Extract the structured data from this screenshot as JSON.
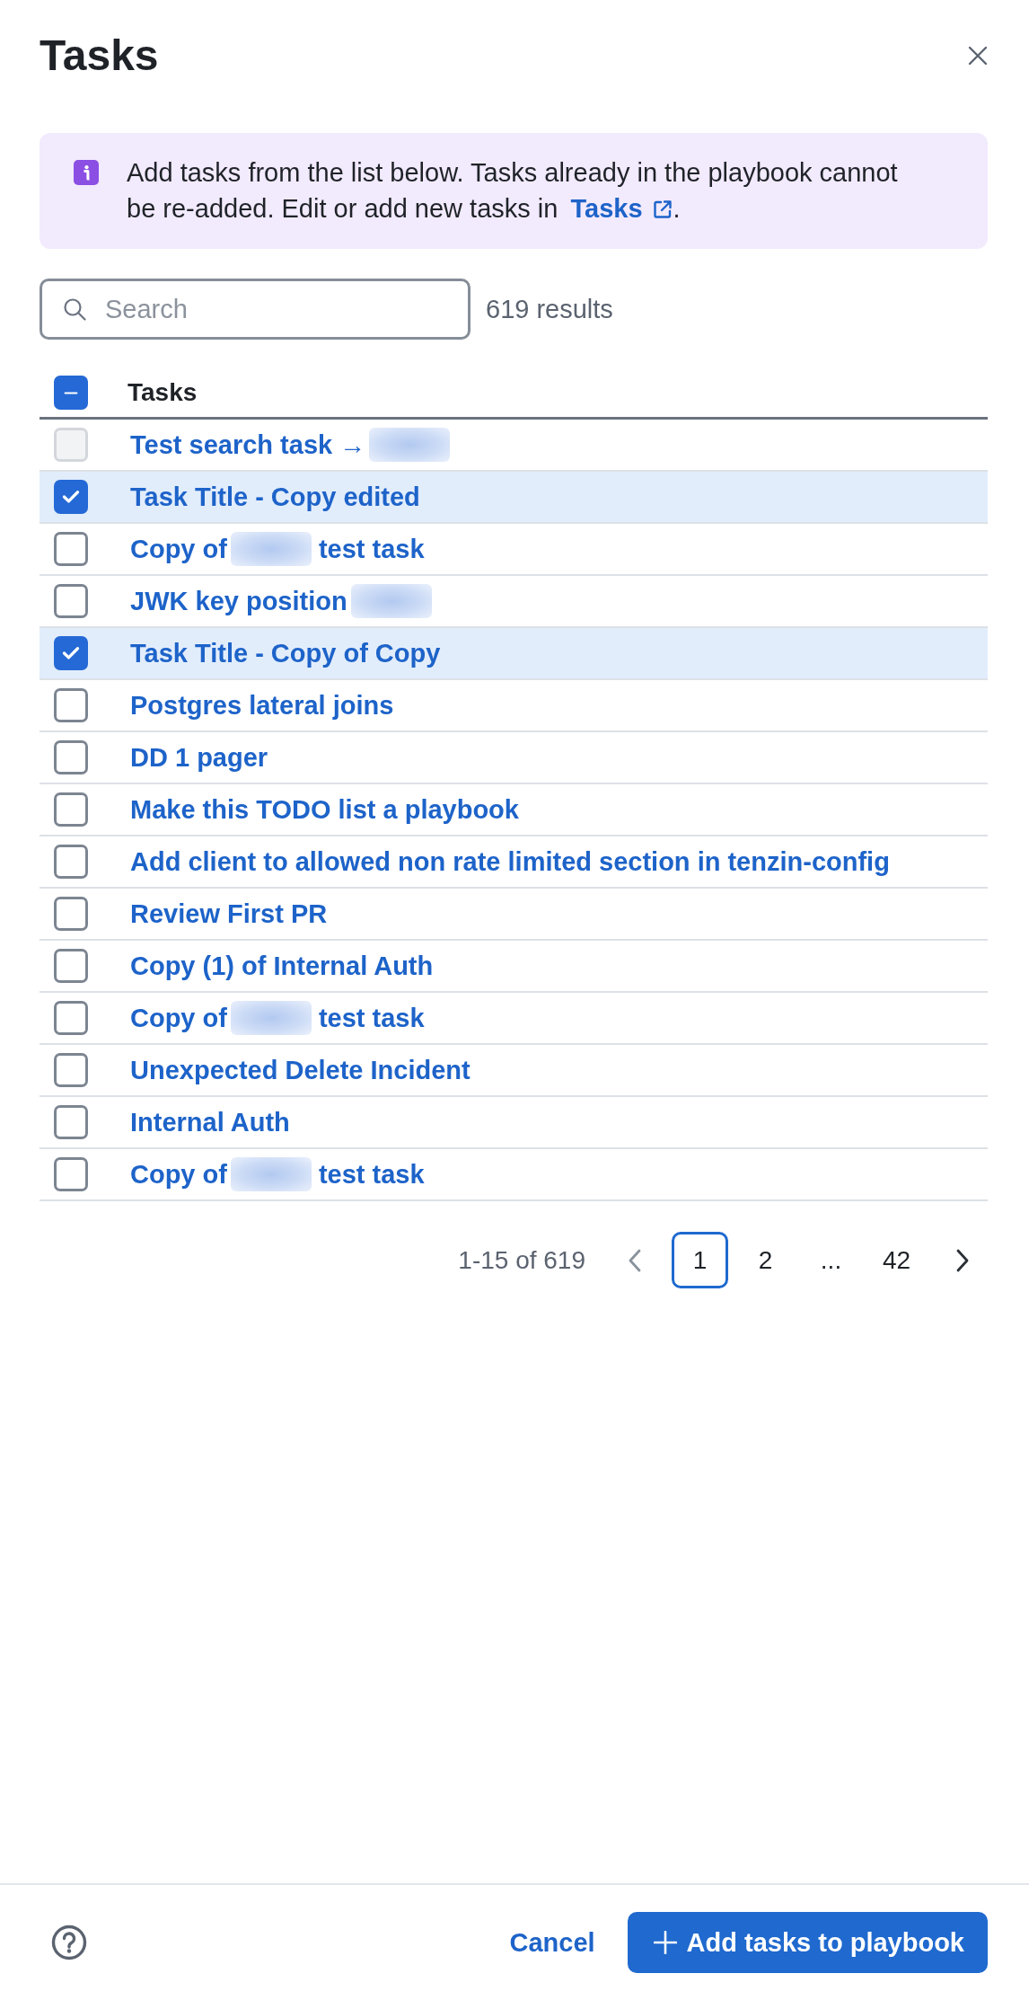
{
  "dialog": {
    "title": "Tasks"
  },
  "info_banner": {
    "text": "Add tasks from the list below. Tasks already in the playbook cannot be re-added. Edit or add new tasks in",
    "link": "Tasks",
    "after_link": "."
  },
  "search": {
    "placeholder": "Search",
    "result_count": "619 results"
  },
  "table": {
    "column": "Tasks",
    "select_all_indeterminate": true,
    "rows": [
      {
        "parts": [
          {
            "kind": "text",
            "text": "Test search task →"
          },
          {
            "kind": "redaction"
          }
        ],
        "checked": false,
        "disabled": true
      },
      {
        "parts": [
          {
            "kind": "text",
            "text": "Task Title - Copy edited"
          }
        ],
        "checked": true,
        "disabled": false
      },
      {
        "parts": [
          {
            "kind": "text",
            "text": "Copy of"
          },
          {
            "kind": "redaction"
          },
          {
            "kind": "text",
            "text": "test task"
          }
        ],
        "checked": false,
        "disabled": false
      },
      {
        "parts": [
          {
            "kind": "text",
            "text": "JWK key position"
          },
          {
            "kind": "redaction"
          }
        ],
        "checked": false,
        "disabled": false
      },
      {
        "parts": [
          {
            "kind": "text",
            "text": "Task Title - Copy of Copy"
          }
        ],
        "checked": true,
        "disabled": false
      },
      {
        "parts": [
          {
            "kind": "text",
            "text": "Postgres lateral joins"
          }
        ],
        "checked": false,
        "disabled": false
      },
      {
        "parts": [
          {
            "kind": "text",
            "text": "DD 1 pager"
          }
        ],
        "checked": false,
        "disabled": false
      },
      {
        "parts": [
          {
            "kind": "text",
            "text": "Make this TODO list a playbook"
          }
        ],
        "checked": false,
        "disabled": false
      },
      {
        "parts": [
          {
            "kind": "text",
            "text": "Add client to allowed non rate limited section in tenzin-config"
          }
        ],
        "checked": false,
        "disabled": false
      },
      {
        "parts": [
          {
            "kind": "text",
            "text": "Review First PR"
          }
        ],
        "checked": false,
        "disabled": false
      },
      {
        "parts": [
          {
            "kind": "text",
            "text": "Copy (1) of Internal Auth"
          }
        ],
        "checked": false,
        "disabled": false
      },
      {
        "parts": [
          {
            "kind": "text",
            "text": "Copy of"
          },
          {
            "kind": "redaction"
          },
          {
            "kind": "text",
            "text": "test task"
          }
        ],
        "checked": false,
        "disabled": false
      },
      {
        "parts": [
          {
            "kind": "text",
            "text": "Unexpected Delete Incident"
          }
        ],
        "checked": false,
        "disabled": false
      },
      {
        "parts": [
          {
            "kind": "text",
            "text": "Internal Auth"
          }
        ],
        "checked": false,
        "disabled": false
      },
      {
        "parts": [
          {
            "kind": "text",
            "text": "Copy of"
          },
          {
            "kind": "redaction"
          },
          {
            "kind": "text",
            "text": "test task"
          }
        ],
        "checked": false,
        "disabled": false
      }
    ]
  },
  "pagination": {
    "range": "1-15 of 619",
    "previous_disabled": true,
    "next_disabled": false,
    "pages": [
      {
        "kind": "page",
        "label": "1",
        "selected": true
      },
      {
        "kind": "page",
        "label": "2",
        "selected": false
      },
      {
        "kind": "ellipsis",
        "label": "..."
      },
      {
        "kind": "page",
        "label": "42",
        "selected": false
      }
    ]
  },
  "footer": {
    "cancel": "Cancel",
    "submit": "Add tasks to playbook"
  }
}
